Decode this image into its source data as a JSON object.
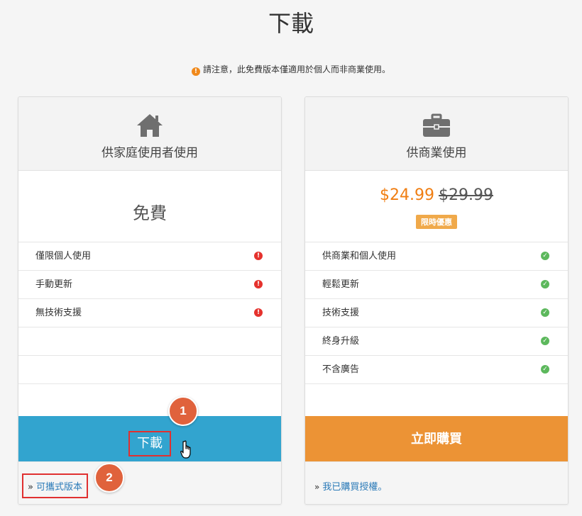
{
  "page": {
    "title": "下載",
    "notice": "請注意，此免費版本僅適用於個人而非商業使用。"
  },
  "colors": {
    "download_button": "#32a4cf",
    "buy_button": "#ec9335",
    "price": "#f07e12",
    "step_badge": "#e0623c",
    "highlight_border": "#e03030",
    "check": "#5cb85c",
    "warning": "#e5322d"
  },
  "free_plan": {
    "icon": "home-icon",
    "title": "供家庭使用者使用",
    "price_label": "免費",
    "features": [
      {
        "label": "僅限個人使用",
        "icon": "exclamation-icon"
      },
      {
        "label": "手動更新",
        "icon": "exclamation-icon"
      },
      {
        "label": "無技術支援",
        "icon": "exclamation-icon"
      }
    ],
    "button_label": "下載",
    "footer_link": "可攜式版本",
    "footer_chevron": "»"
  },
  "business_plan": {
    "icon": "briefcase-icon",
    "title": "供商業使用",
    "price_now": "$24.99",
    "price_old": "$29.99",
    "promo_badge": "限時優惠",
    "features": [
      {
        "label": "供商業和個人使用",
        "icon": "check-icon"
      },
      {
        "label": "輕鬆更新",
        "icon": "check-icon"
      },
      {
        "label": "技術支援",
        "icon": "check-icon"
      },
      {
        "label": "終身升級",
        "icon": "check-icon"
      },
      {
        "label": "不含廣告",
        "icon": "check-icon"
      }
    ],
    "button_label": "立即購買",
    "footer_link": "我已購買授權。",
    "footer_chevron": "»"
  },
  "steps": {
    "step1": "1",
    "step2": "2"
  },
  "glyphs": {
    "exclamation": "!",
    "check": "✓"
  }
}
